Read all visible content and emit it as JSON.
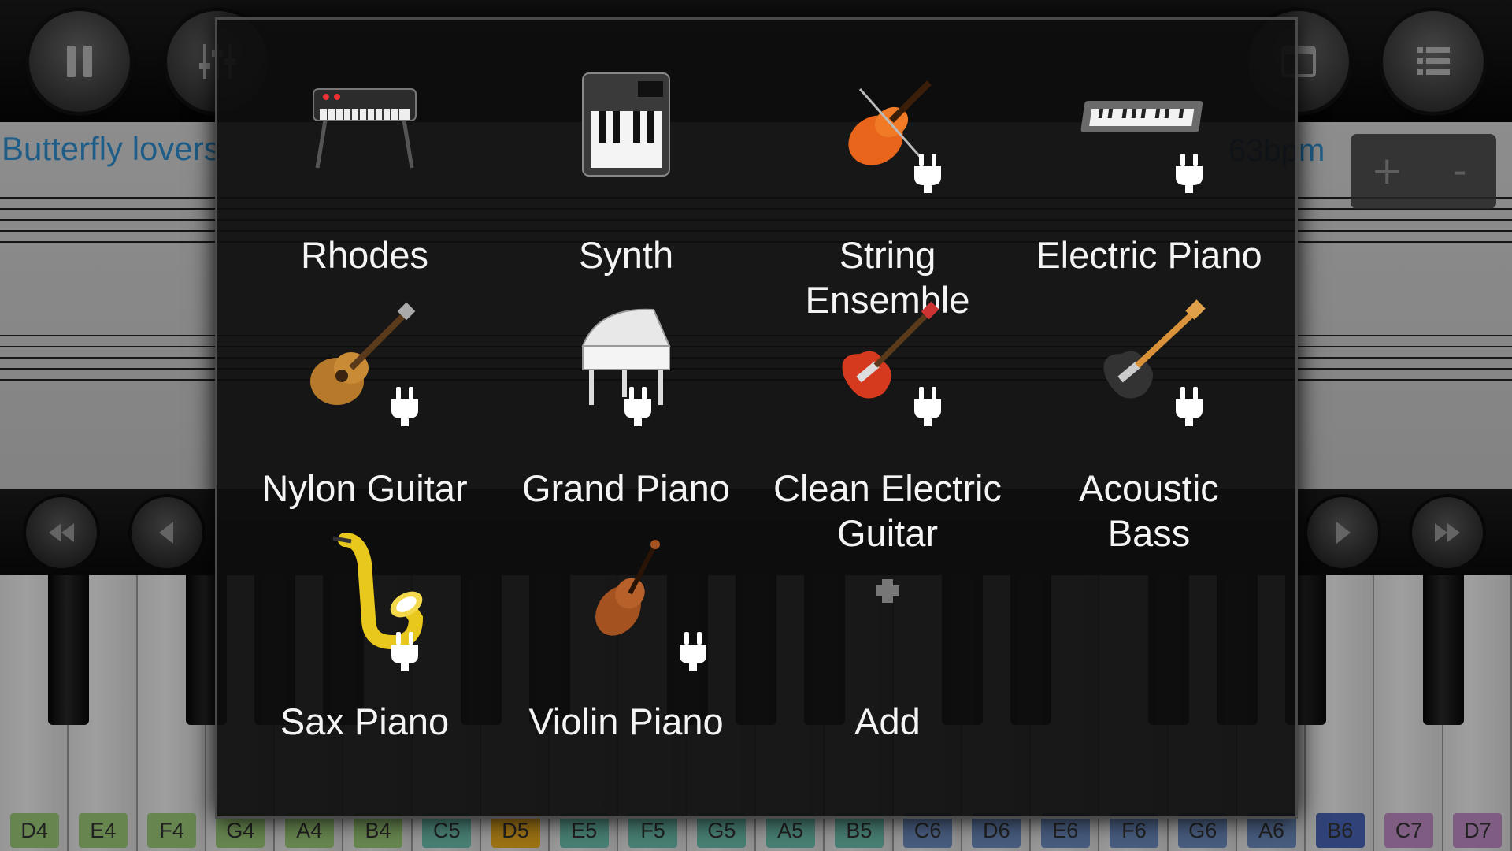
{
  "toolbar": {
    "pause_icon": "pause-icon",
    "mixer_icon": "mixer-icon",
    "layout_icon": "window-icon",
    "menu_icon": "list-menu-icon"
  },
  "sheet": {
    "song_title": "Butterfly lovers",
    "tempo": "63bpm",
    "zoom_in": "+",
    "zoom_out": "-"
  },
  "transport": {
    "rewind_icon": "fast-rewind-icon",
    "prev_icon": "previous-icon",
    "play_icon": "play-icon",
    "forward_icon": "fast-forward-icon"
  },
  "keyboard": {
    "keys": [
      {
        "label": "D4",
        "color": "#9fce7a"
      },
      {
        "label": "E4",
        "color": "#9fce7a"
      },
      {
        "label": "F4",
        "color": "#9fce7a"
      },
      {
        "label": "G4",
        "color": "#9fce7a"
      },
      {
        "label": "A4",
        "color": "#9fce7a"
      },
      {
        "label": "B4",
        "color": "#9fce7a"
      },
      {
        "label": "C5",
        "color": "#6fc3b3"
      },
      {
        "label": "D5",
        "color": "#f0b020"
      },
      {
        "label": "E5",
        "color": "#6fc3b3"
      },
      {
        "label": "F5",
        "color": "#6fc3b3"
      },
      {
        "label": "G5",
        "color": "#6fc3b3"
      },
      {
        "label": "A5",
        "color": "#6fc3b3"
      },
      {
        "label": "B5",
        "color": "#6fc3b3"
      },
      {
        "label": "C6",
        "color": "#6f8fc3"
      },
      {
        "label": "D6",
        "color": "#6f8fc3"
      },
      {
        "label": "E6",
        "color": "#6f8fc3"
      },
      {
        "label": "F6",
        "color": "#6f8fc3"
      },
      {
        "label": "G6",
        "color": "#6f8fc3"
      },
      {
        "label": "A6",
        "color": "#6f8fc3"
      },
      {
        "label": "B6",
        "color": "#4a67b8"
      },
      {
        "label": "C7",
        "color": "#c38fc8"
      },
      {
        "label": "D7",
        "color": "#c38fc8"
      }
    ]
  },
  "dialog": {
    "instruments": [
      {
        "name": "Rhodes",
        "icon": "rhodes-keyboard-icon",
        "plugin": false
      },
      {
        "name": "Synth",
        "icon": "synth-icon",
        "plugin": false
      },
      {
        "name": "String Ensemble",
        "icon": "violin-bow-icon",
        "plugin": true
      },
      {
        "name": "Electric Piano",
        "icon": "electric-piano-icon",
        "plugin": true
      },
      {
        "name": "Nylon Guitar",
        "icon": "acoustic-guitar-icon",
        "plugin": true
      },
      {
        "name": "Grand Piano",
        "icon": "grand-piano-icon",
        "plugin": true
      },
      {
        "name": "Clean Electric Guitar",
        "icon": "electric-guitar-icon",
        "plugin": true
      },
      {
        "name": "Acoustic Bass",
        "icon": "bass-guitar-icon",
        "plugin": true
      },
      {
        "name": "Sax Piano",
        "icon": "saxophone-icon",
        "plugin": true
      },
      {
        "name": "Violin Piano",
        "icon": "violin-icon",
        "plugin": true
      },
      {
        "name": "Add",
        "icon": "add-icon",
        "plugin": false
      }
    ]
  }
}
